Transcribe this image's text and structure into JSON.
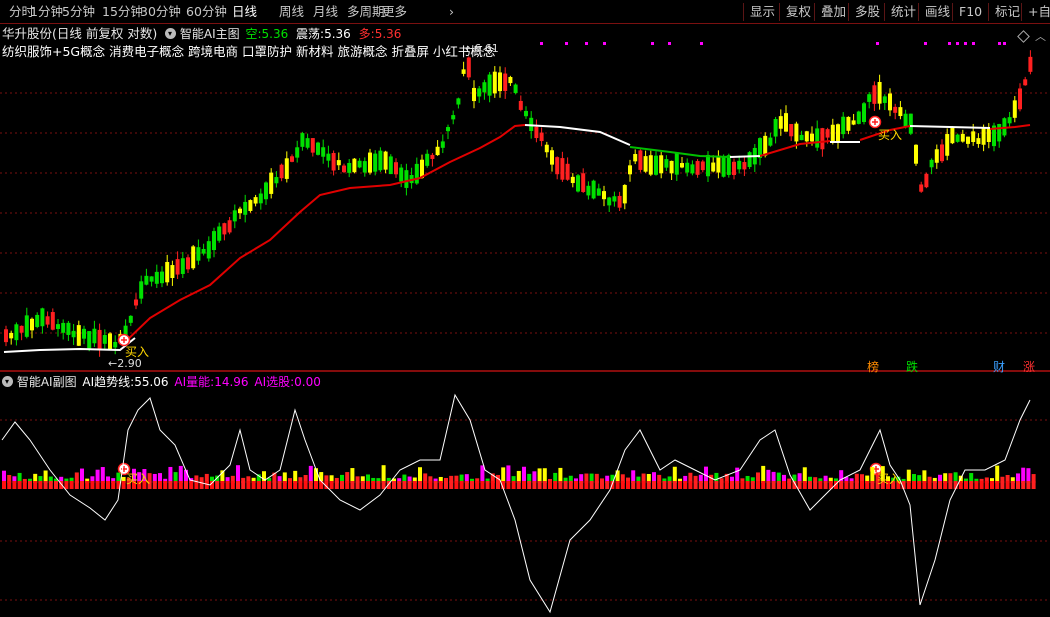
{
  "toolbar": {
    "left": [
      {
        "label": "分时",
        "active": false
      },
      {
        "label": "1分钟",
        "active": false
      },
      {
        "label": "5分钟",
        "active": false
      },
      {
        "label": "15分钟",
        "active": false
      },
      {
        "label": "30分钟",
        "active": false
      },
      {
        "label": "60分钟",
        "active": false
      },
      {
        "label": "日线",
        "active": true
      },
      {
        "label": "周线",
        "active": false
      },
      {
        "label": "月线",
        "active": false
      },
      {
        "label": "多周期",
        "active": false
      },
      {
        "label": "更多",
        "active": false
      }
    ],
    "more_arrow": "›",
    "right": [
      "显示",
      "复权",
      "叠加",
      "多股",
      "统计",
      "画线",
      "F10",
      "标记",
      "+自选"
    ]
  },
  "main_chart": {
    "stock_name": "华升股份",
    "period_info": "(日线 前复权 对数)",
    "indicator_name": "智能AI主图",
    "stat_kong_label": "空:",
    "stat_kong_value": "5.36",
    "stat_zhendang_label": "震荡:",
    "stat_zhendang_value": "5.36",
    "stat_duo_label": "多:",
    "stat_duo_value": "5.36",
    "concepts": "纺织服饰+5G概念 消费电子概念 跨境电商 口罩防护 新材料 旅游概念 折叠屏 小红书概念",
    "high_label": "6.61",
    "low_label": "2.90",
    "buy_label": "买入",
    "event_labels": [
      {
        "text": "榜",
        "color": "#ff8c00"
      },
      {
        "text": "跌",
        "color": "#00e000"
      },
      {
        "text": "财",
        "color": "#3aa0ff"
      },
      {
        "text": "涨",
        "color": "#ff3030"
      }
    ]
  },
  "sub_chart": {
    "indicator_name": "智能AI副图",
    "trend_label": "AI趋势线:",
    "trend_value": "55.06",
    "volume_label": "AI量能:",
    "volume_value": "14.96",
    "select_label": "AI选股:",
    "select_value": "0.00",
    "buy_label": "买入"
  },
  "colors": {
    "background": "#000000",
    "up_yellow": "#ffff00",
    "up_red": "#ff2020",
    "down_green": "#00e000",
    "ma_red": "#e00000",
    "ma_white": "#ffffff",
    "magenta": "#ff00ff",
    "grid": "#7a1010"
  },
  "icons": [
    "circle-icon",
    "diamond-icon",
    "chevron-up-icon",
    "chevron-right-icon",
    "buy-marker-icon"
  ]
}
